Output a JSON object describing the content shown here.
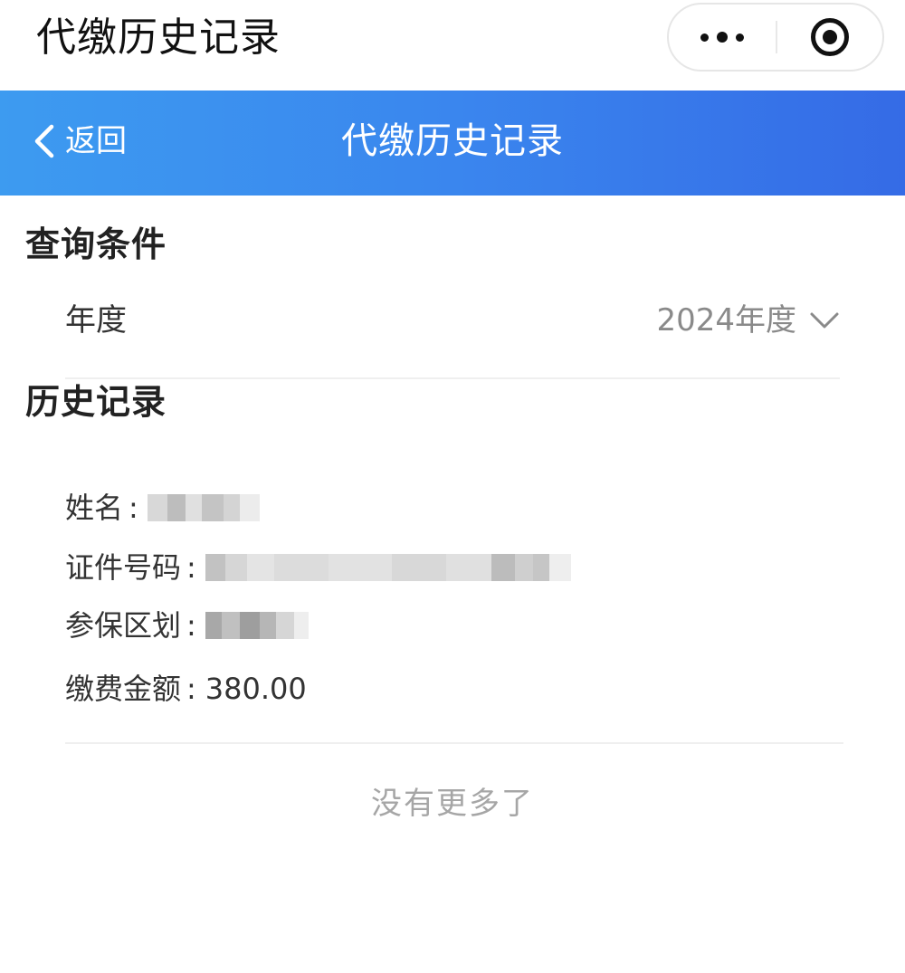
{
  "app_titlebar": {
    "title": "代缴历史记录",
    "more_icon": "more-dots-icon",
    "close_icon": "target-close-icon"
  },
  "nav": {
    "back_label": "返回",
    "back_icon": "chevron-left-icon",
    "title": "代缴历史记录"
  },
  "query": {
    "heading": "查询条件",
    "year_label": "年度",
    "year_value": "2024年度",
    "dropdown_icon": "chevron-down-icon"
  },
  "history": {
    "heading": "历史记录",
    "records": [
      {
        "name_label": "姓名",
        "id_label": "证件号码",
        "region_label": "参保区划",
        "amount_label": "缴费金额",
        "amount_value": "380.00"
      }
    ],
    "end_text": "没有更多了"
  },
  "colors": {
    "header_gradient_start": "#3d9bf0",
    "header_gradient_end": "#356be6",
    "muted_text": "#a6a6a6"
  }
}
